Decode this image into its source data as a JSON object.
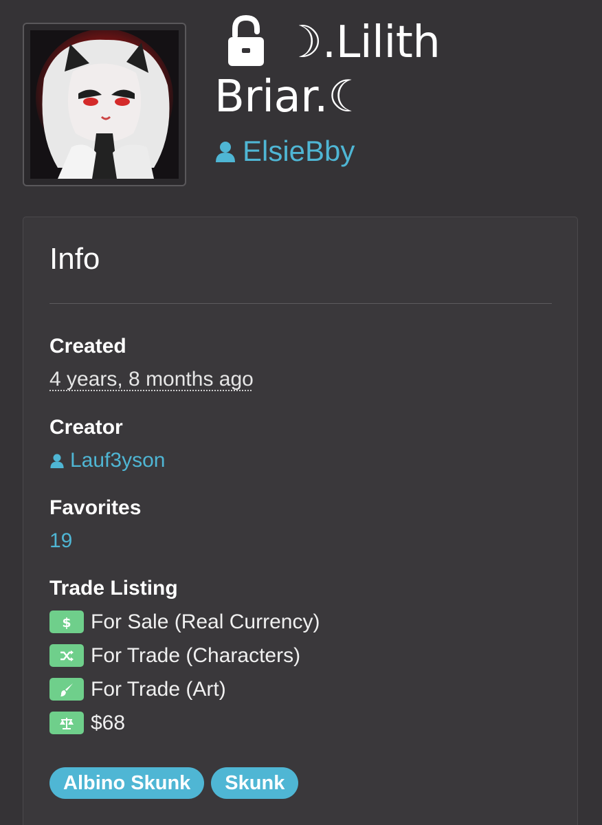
{
  "character": {
    "name_line1": "☽.Lilith",
    "name_line2": "Briar.☾",
    "owner": "ElsieBby"
  },
  "info": {
    "heading": "Info",
    "created_label": "Created",
    "created_value": "4 years, 8 months ago",
    "creator_label": "Creator",
    "creator_value": "Lauf3yson",
    "favorites_label": "Favorites",
    "favorites_value": "19",
    "trade_label": "Trade Listing",
    "trade_items": [
      {
        "icon": "dollar-icon",
        "text": "For Sale (Real Currency)"
      },
      {
        "icon": "shuffle-icon",
        "text": "For Trade (Characters)"
      },
      {
        "icon": "paintbrush-icon",
        "text": "For Trade (Art)"
      },
      {
        "icon": "scale-icon",
        "text": "$68"
      }
    ],
    "tags": [
      "Albino Skunk",
      "Skunk"
    ]
  },
  "colors": {
    "background": "#353336",
    "card": "#3a383b",
    "link": "#4fb6d4",
    "trade_badge": "#6fcf8b"
  }
}
